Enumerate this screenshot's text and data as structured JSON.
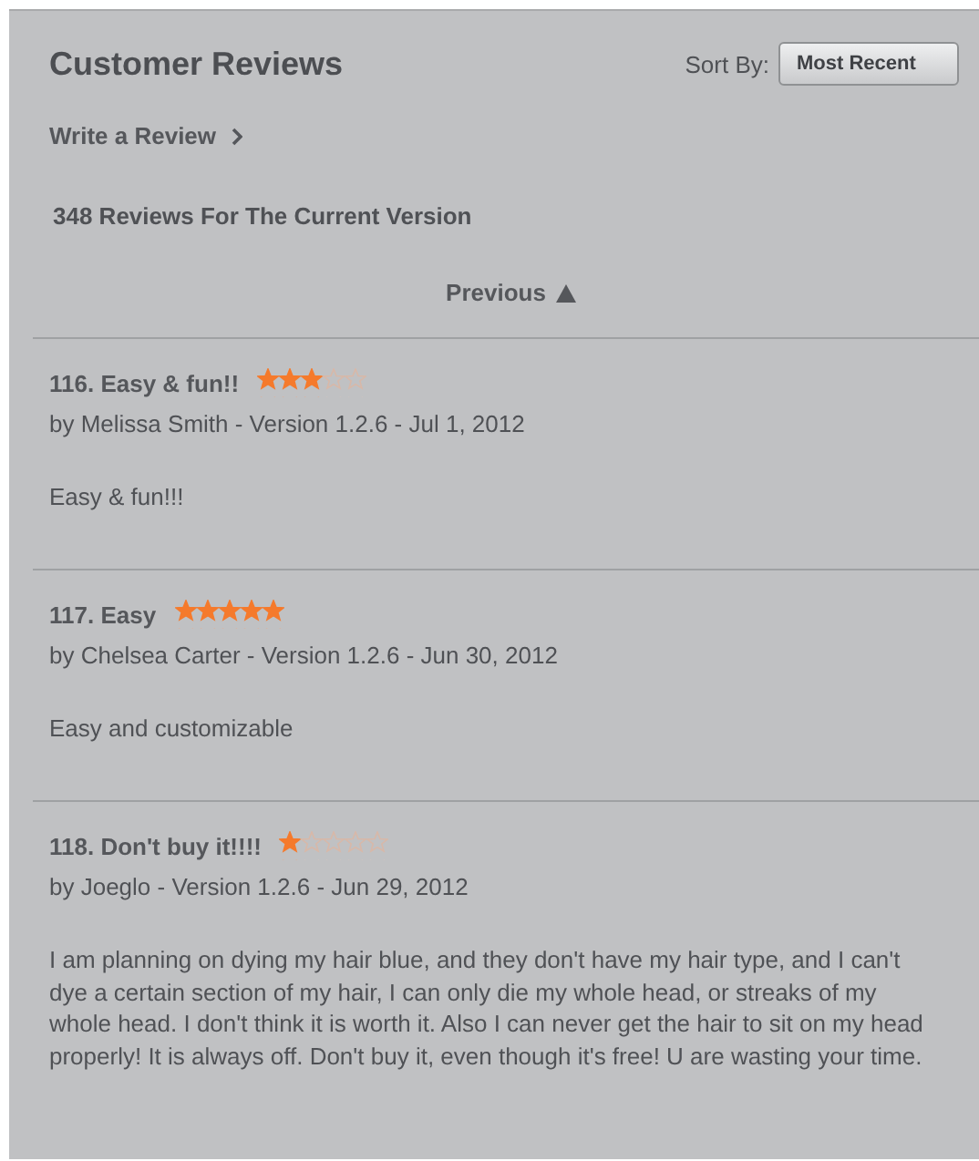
{
  "header": {
    "title": "Customer Reviews",
    "sort_label": "Sort By:",
    "sort_value": "Most Recent"
  },
  "write_review": "Write a Review",
  "review_count": "348 Reviews For The Current Version",
  "previous": "Previous",
  "reviews": [
    {
      "title": "116. Easy & fun!!",
      "stars": 3,
      "byline": "by Melissa Smith - Version 1.2.6 - Jul 1, 2012",
      "body": "Easy & fun!!!"
    },
    {
      "title": "117. Easy",
      "stars": 5,
      "byline": "by Chelsea Carter - Version 1.2.6 - Jun 30, 2012",
      "body": "Easy and customizable"
    },
    {
      "title": "118. Don't buy it!!!!",
      "stars": 1,
      "byline": "by Joeglo - Version 1.2.6 - Jun 29, 2012",
      "body": "I am planning on dying my hair blue, and they don't have my hair type, and I can't dye a certain section of my hair, I can only die my whole head, or streaks of my whole head. I don't think it is worth it. Also I can never get the hair to sit on my head properly! It is always off. Don't buy it, even though it's free! U are wasting your time."
    }
  ]
}
